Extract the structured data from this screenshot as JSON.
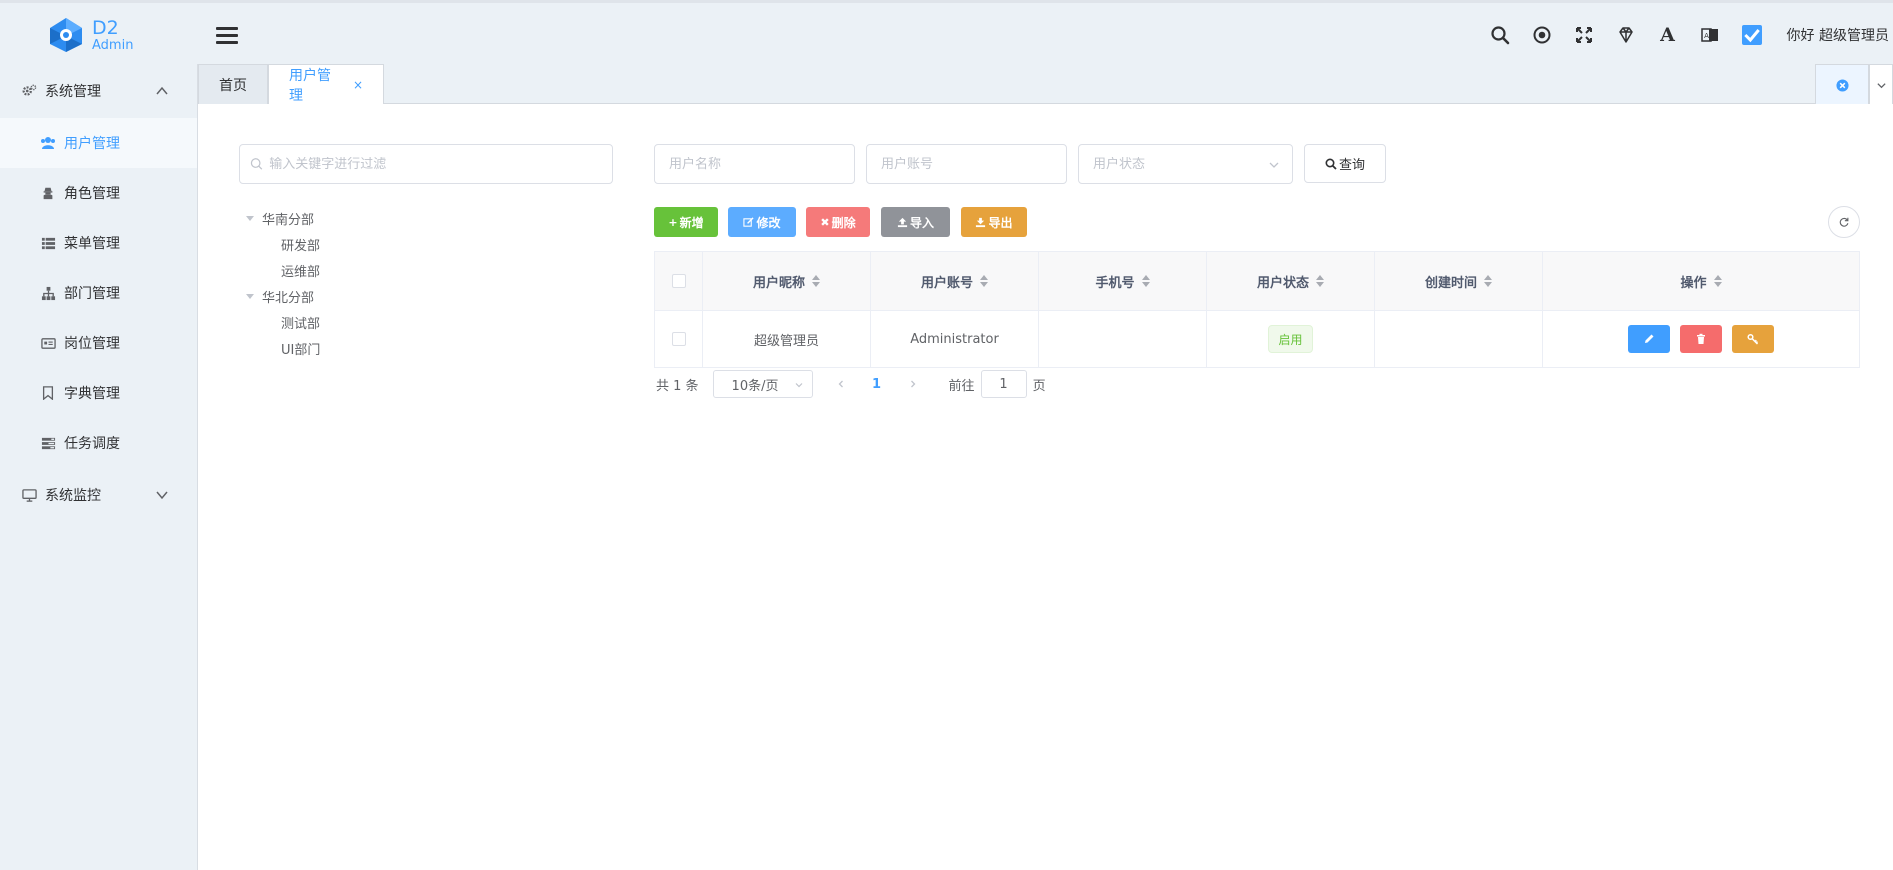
{
  "app": {
    "logo_title": "D2",
    "logo_subtitle": "Admin",
    "greeting": "你好 超级管理员"
  },
  "header_icons": [
    "search-icon",
    "record-icon",
    "fullscreen-icon",
    "theme-diamond-icon",
    "font-size-icon",
    "language-icon",
    "avatar-icon"
  ],
  "header": {
    "font_glyph": "A"
  },
  "sidebar": {
    "groups": [
      {
        "label": "系统管理",
        "icon": "gears-icon",
        "expanded": true,
        "items": [
          {
            "label": "用户管理",
            "icon": "users-icon",
            "active": true
          },
          {
            "label": "角色管理",
            "icon": "user-secret-icon"
          },
          {
            "label": "菜单管理",
            "icon": "list-icon"
          },
          {
            "label": "部门管理",
            "icon": "sitemap-icon"
          },
          {
            "label": "岗位管理",
            "icon": "id-card-icon"
          },
          {
            "label": "字典管理",
            "icon": "bookmark-icon"
          },
          {
            "label": "任务调度",
            "icon": "tasks-icon"
          }
        ]
      },
      {
        "label": "系统监控",
        "icon": "desktop-icon",
        "expanded": false
      }
    ]
  },
  "tabs": [
    {
      "label": "首页",
      "active": false
    },
    {
      "label": "用户管理",
      "active": true,
      "close": "×"
    }
  ],
  "dept_filter": {
    "placeholder": "输入关键字进行过滤"
  },
  "dept_tree": [
    {
      "label": "华南分部",
      "children": [
        "研发部",
        "运维部"
      ]
    },
    {
      "label": "华北分部",
      "children": [
        "测试部",
        "UI部门"
      ]
    }
  ],
  "query": {
    "name_placeholder": "用户名称",
    "account_placeholder": "用户账号",
    "status_placeholder": "用户状态",
    "search_label": "查询"
  },
  "toolbar": {
    "add": "新增",
    "edit": "修改",
    "delete": "删除",
    "import": "导入",
    "export": "导出"
  },
  "colors": {
    "primary": "#409eff",
    "success": "#67c23a",
    "danger": "#f56c6c",
    "warning": "#e6a23c",
    "info": "#909399"
  },
  "table": {
    "columns": [
      "用户昵称",
      "用户账号",
      "手机号",
      "用户状态",
      "创建时间",
      "操作"
    ],
    "rows": [
      {
        "nickname": "超级管理员",
        "account": "Administrator",
        "phone": "",
        "status": "启用",
        "created": ""
      }
    ]
  },
  "pagination": {
    "total": "共 1 条",
    "page_size": "10条/页",
    "current": "1",
    "goto_prefix": "前往",
    "goto_value": "1",
    "goto_suffix": "页"
  }
}
